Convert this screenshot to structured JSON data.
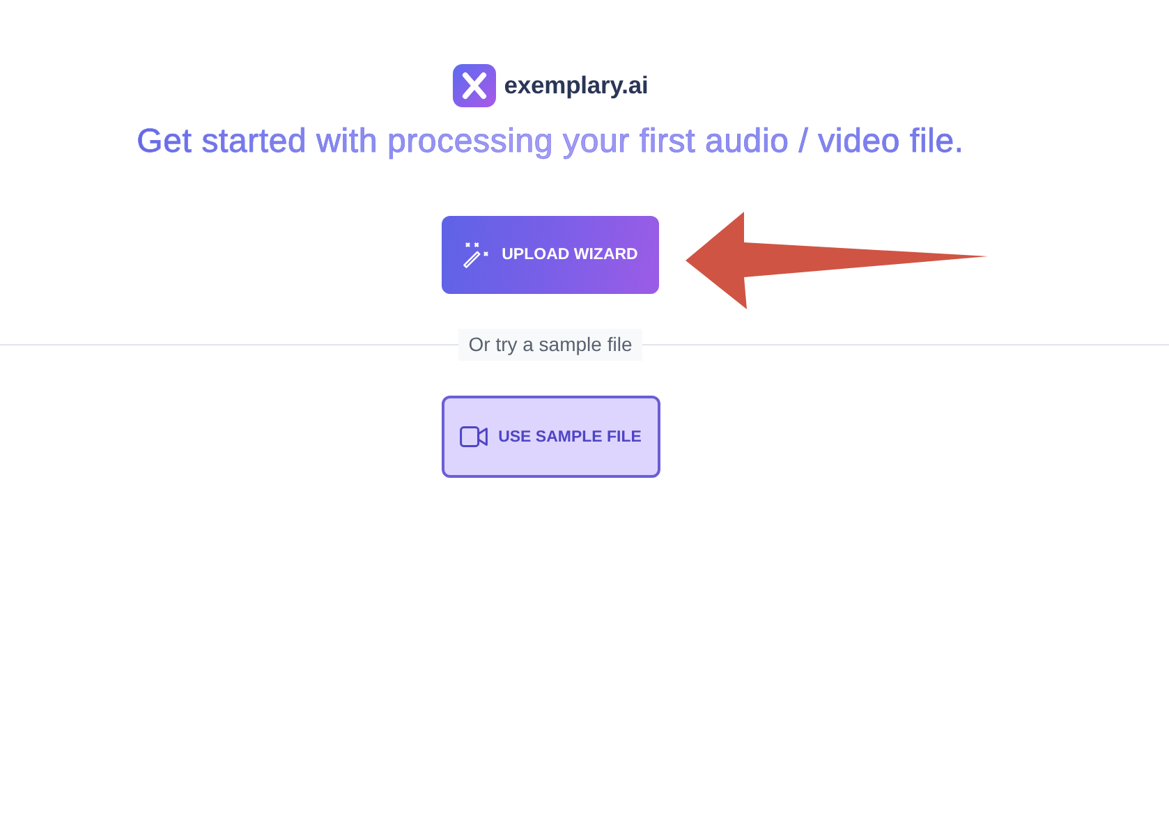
{
  "logo": {
    "name": "exemplary.ai"
  },
  "heading": "Get started with processing your first audio / video file.",
  "upload_button": {
    "label": "UPLOAD WIZARD"
  },
  "divider": {
    "label": "Or try a sample file"
  },
  "sample_button": {
    "label": "USE SAMPLE FILE"
  },
  "annotation": {
    "kind": "arrow"
  }
}
